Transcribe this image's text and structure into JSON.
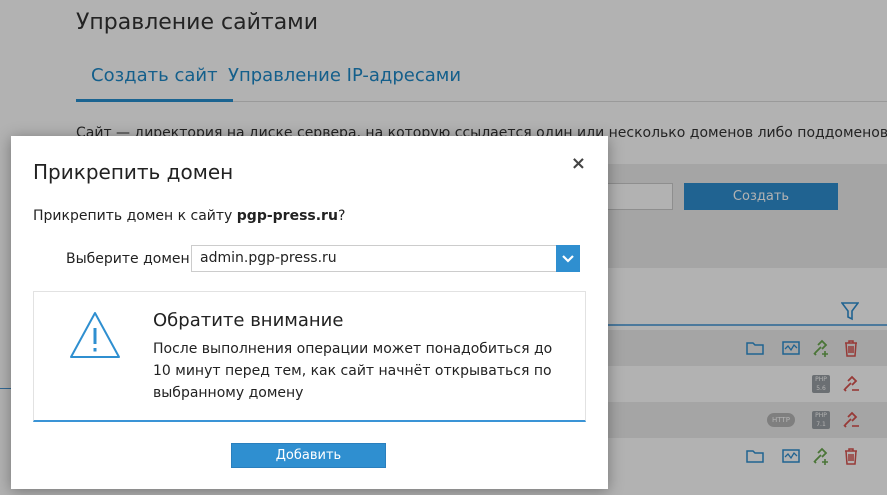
{
  "page": {
    "title": "Управление сайтами",
    "tabs": [
      {
        "label": "Создать сайт",
        "active": true
      },
      {
        "label": "Управление IP-адресами",
        "active": false
      }
    ],
    "description": "Сайт — директория на диске сервера, на которую ссылается один или несколько доменов либо поддоменов.",
    "create_button": "Создать",
    "badge_http": "HTTP",
    "php_label": "PHP",
    "php_versions": [
      "5.6",
      "7.1"
    ]
  },
  "modal": {
    "title": "Прикрепить домен",
    "close_symbol": "×",
    "question_prefix": "Прикрепить домен к сайту ",
    "site_name": "pgp-press.ru",
    "question_suffix": "?",
    "select_label": "Выберите домен:",
    "selected_domain": "admin.pgp-press.ru",
    "notice": {
      "title": "Обратите внимание",
      "text": "После выполнения операции может понадобиться до 10 минут перед тем, как сайт начнёт открываться по выбранному домену"
    },
    "add_button": "Добавить"
  },
  "colors": {
    "accent": "#2f8fd0",
    "warning_icon": "#2f8fd0",
    "delete": "#d9534f",
    "link_ok": "#6aa84f"
  }
}
